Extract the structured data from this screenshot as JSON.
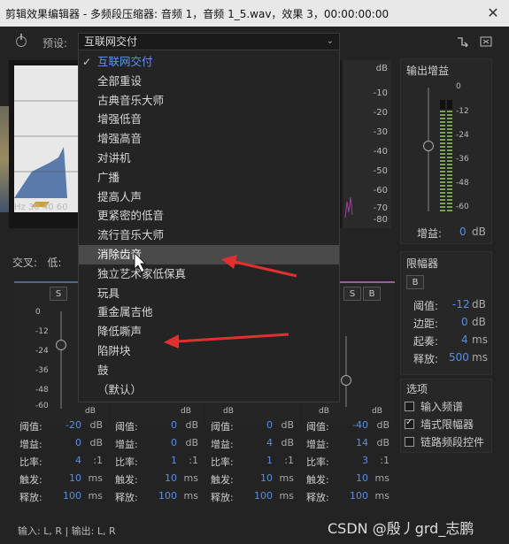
{
  "window": {
    "title": "剪辑效果编辑器 - 多频段压缩器: 音频 1，音频 1_5.wav，效果 3，00:00:00:00",
    "close": "✕"
  },
  "toolbar": {
    "preset_label": "预设:",
    "preset_value": "互联网交付",
    "dropdown_arrow": "⌄"
  },
  "graph": {
    "db_ticks": [
      "dB",
      "-10",
      "-20",
      "-30",
      "-40",
      "-50",
      "-60",
      "-70",
      "-80"
    ],
    "hz_label": "Hz  30  40  60"
  },
  "output": {
    "title": "输出增益",
    "ticks": [
      "0",
      "-12",
      "-24",
      "-36",
      "-48",
      "-60"
    ],
    "gain_label": "增益:",
    "gain_value": "0",
    "gain_unit": "dB"
  },
  "limiter": {
    "title": "限幅器",
    "b_button": "B",
    "rows": [
      {
        "label": "阈值:",
        "value": "-12",
        "unit": "dB"
      },
      {
        "label": "边距:",
        "value": "0",
        "unit": "dB"
      },
      {
        "label": "起奏:",
        "value": "4",
        "unit": "ms"
      },
      {
        "label": "释放:",
        "value": "500",
        "unit": "ms"
      }
    ]
  },
  "options": {
    "title": "选项",
    "items": [
      {
        "label": "输入频谱",
        "checked": false
      },
      {
        "label": "墙式限幅器",
        "checked": true
      },
      {
        "label": "链路频段控件",
        "checked": false
      }
    ]
  },
  "crossover": {
    "label": "交叉:",
    "low": "低:"
  },
  "band_ticks": [
    "0",
    "-12",
    "-24",
    "-36",
    "-48",
    "-60"
  ],
  "bands": [
    {
      "s": "S",
      "b": "",
      "threshold": "-20",
      "gain": "0",
      "ratio": "4",
      "attack": "10",
      "release": "100"
    },
    {
      "s": "",
      "b": "",
      "threshold": "0",
      "gain": "0",
      "ratio": "1",
      "attack": "10",
      "release": "100"
    },
    {
      "s": "",
      "b": "",
      "threshold": "0",
      "gain": "4",
      "ratio": "1",
      "attack": "10",
      "release": "100"
    },
    {
      "s": "S",
      "b": "B",
      "threshold": "-40",
      "gain": "14",
      "ratio": "3",
      "attack": "10",
      "release": "100"
    }
  ],
  "param_labels": {
    "threshold": "阈值:",
    "gain": "增益:",
    "ratio": "比率:",
    "attack": "触发:",
    "release": "释放:"
  },
  "units": {
    "db": "dB",
    "ms": "ms",
    "ratio": ":1"
  },
  "meter_units": [
    "dB",
    "dB"
  ],
  "io": "输入: L, R | 输出: L, R",
  "dropdown": {
    "items": [
      "互联网交付",
      "全部重设",
      "古典音乐大师",
      "增强低音",
      "增强高音",
      "对讲机",
      "广播",
      "提高人声",
      "更紧密的低音",
      "流行音乐大师",
      "消除齿音",
      "独立艺术家低保真",
      "玩具",
      "重金属吉他",
      "降低嘶声",
      "陷阱块",
      "鼓",
      "（默认）"
    ],
    "selected_index": 0,
    "highlighted_index": 10
  },
  "watermark": "CSDN @殷丿grd_志鹏",
  "colors": {
    "accent": "#5a97f0",
    "arrow": "#e03030",
    "meter_green": "#7aa54a"
  }
}
